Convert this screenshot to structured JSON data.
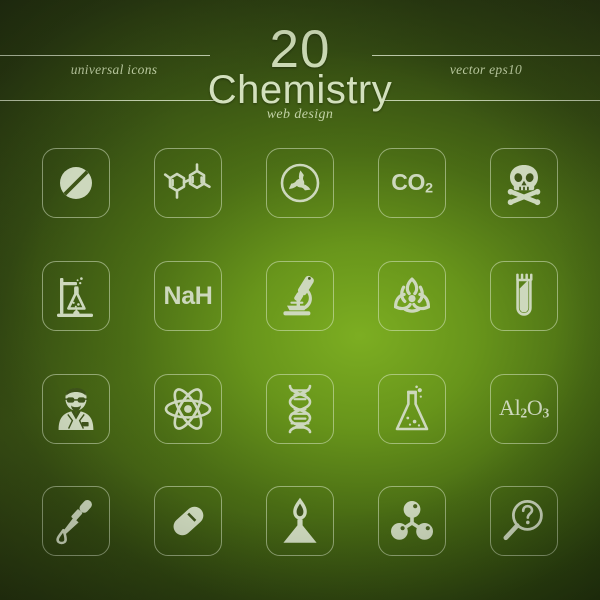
{
  "header": {
    "count": "20",
    "title": "Chemistry",
    "subtitle": "web design",
    "left_tag": "universal icons",
    "right_tag": "vector eps10"
  },
  "theme": {
    "icon_color": "#cdd8bd",
    "tile_border": "rgba(226,238,210,0.50)",
    "bg_bright_green": "#7eb022",
    "bg_dark_olive": "#161d0a"
  },
  "grid": {
    "columns": 5,
    "rows": 4,
    "icons": [
      {
        "id": "pill-tablet",
        "name": "tablet-icon",
        "label": "",
        "type": "shape"
      },
      {
        "id": "benzene-rings",
        "name": "molecule-rings-icon",
        "label": "",
        "type": "shape"
      },
      {
        "id": "radioactive",
        "name": "radiation-icon",
        "label": "",
        "type": "shape"
      },
      {
        "id": "carbon-dioxide",
        "name": "co2-formula-icon",
        "label": "CO",
        "sub": "2",
        "type": "text"
      },
      {
        "id": "skull-crossbones",
        "name": "poison-skull-icon",
        "label": "",
        "type": "shape"
      },
      {
        "id": "burner-flask",
        "name": "bunsen-burner-icon",
        "label": "",
        "type": "shape"
      },
      {
        "id": "sodium-hydride",
        "name": "nah-formula-icon",
        "label": "NaH",
        "type": "text"
      },
      {
        "id": "microscope",
        "name": "microscope-icon",
        "label": "",
        "type": "shape"
      },
      {
        "id": "biohazard",
        "name": "biohazard-icon",
        "label": "",
        "type": "shape"
      },
      {
        "id": "test-tube",
        "name": "test-tube-icon",
        "label": "",
        "type": "shape"
      },
      {
        "id": "scientist",
        "name": "scientist-icon",
        "label": "",
        "type": "shape"
      },
      {
        "id": "atom",
        "name": "atom-icon",
        "label": "",
        "type": "shape"
      },
      {
        "id": "dna-helix",
        "name": "dna-icon",
        "label": "",
        "type": "shape"
      },
      {
        "id": "erlenmeyer-flask",
        "name": "conical-flask-icon",
        "label": "",
        "type": "shape"
      },
      {
        "id": "aluminium-oxide",
        "name": "al2o3-formula-icon",
        "label": "Al",
        "sub": "2",
        "label2": "O",
        "sub2": "3",
        "type": "text"
      },
      {
        "id": "pipette",
        "name": "dropper-pipette-icon",
        "label": "",
        "type": "shape"
      },
      {
        "id": "capsule",
        "name": "capsule-pill-icon",
        "label": "",
        "type": "shape"
      },
      {
        "id": "spirit-lamp",
        "name": "alcohol-burner-icon",
        "label": "",
        "type": "shape"
      },
      {
        "id": "molecule",
        "name": "molecule-atoms-icon",
        "label": "",
        "type": "shape"
      },
      {
        "id": "magnifier-help",
        "name": "magnifier-question-icon",
        "label": "",
        "type": "shape"
      }
    ]
  }
}
